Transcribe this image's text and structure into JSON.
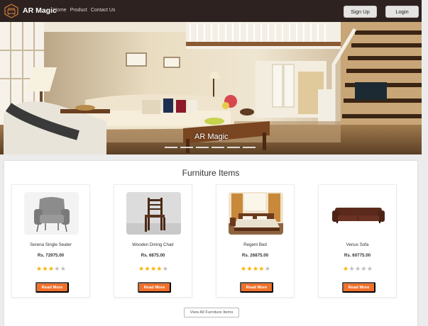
{
  "nav": {
    "brand": "AR Magic",
    "links": [
      "Home",
      "Product",
      "Contact Us"
    ],
    "signup": "Sign Up",
    "login": "Login"
  },
  "hero": {
    "title": "AR Magic"
  },
  "main": {
    "section_title": "Furniture Items",
    "view_all": "View All Furniture Items",
    "products": [
      {
        "name": "Serena Single Seater",
        "price": "Rs. 72975.00",
        "rating": 3,
        "button": "Read More"
      },
      {
        "name": "Wooden Dining Chair",
        "price": "Rs. 6875.00",
        "rating": 4,
        "button": "Read More"
      },
      {
        "name": "Regent Bed",
        "price": "Rs. 26875.00",
        "rating": 4,
        "button": "Read More"
      },
      {
        "name": "Venus Sofa",
        "price": "Rs. 60775.00",
        "rating": 1,
        "button": "Read More"
      }
    ]
  },
  "colors": {
    "navbar": "#2e2220",
    "accent": "#f0712b",
    "star": "#f5b301"
  }
}
